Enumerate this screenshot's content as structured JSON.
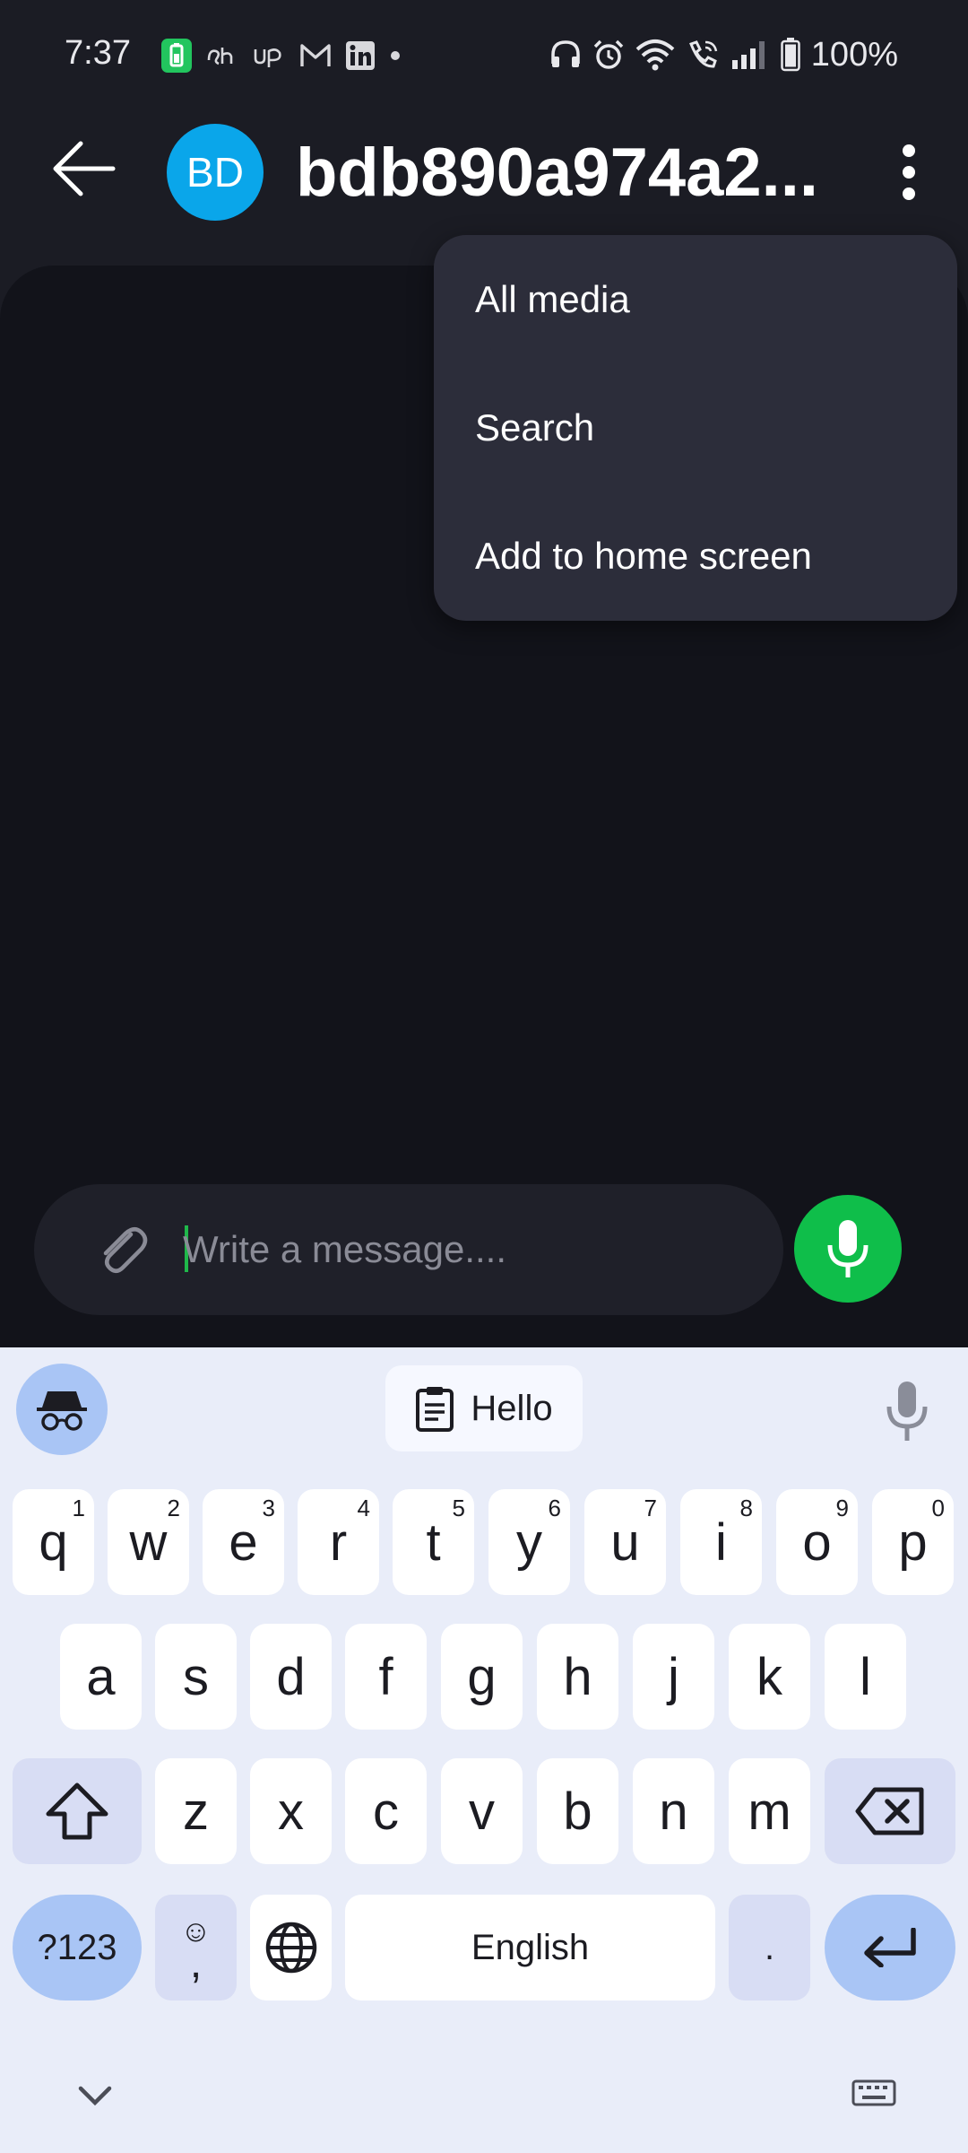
{
  "status_bar": {
    "time": "7:37",
    "battery_text": "100%",
    "left_icons": [
      "battery-saver-icon",
      "dh-app-icon",
      "up-app-icon",
      "gmail-icon",
      "linkedin-icon",
      "more-dot-icon"
    ],
    "right_icons": [
      "headphones-icon",
      "alarm-icon",
      "wifi-icon",
      "wifi-calling-icon",
      "signal-icon",
      "battery-icon"
    ]
  },
  "header": {
    "avatar_initials": "BD",
    "title": "bdb890a974a2...",
    "back_icon": "back-arrow-icon",
    "more_icon": "more-vertical-icon"
  },
  "menu": {
    "items": [
      {
        "label": "All media"
      },
      {
        "label": "Search"
      },
      {
        "label": "Add to home screen"
      }
    ]
  },
  "composer": {
    "placeholder": "Write a message....",
    "value": "",
    "attach_icon": "paperclip-icon",
    "action_icon": "microphone-icon"
  },
  "keyboard": {
    "suggestion_text": "Hello",
    "row1": [
      {
        "key": "q",
        "hint": "1"
      },
      {
        "key": "w",
        "hint": "2"
      },
      {
        "key": "e",
        "hint": "3"
      },
      {
        "key": "r",
        "hint": "4"
      },
      {
        "key": "t",
        "hint": "5"
      },
      {
        "key": "y",
        "hint": "6"
      },
      {
        "key": "u",
        "hint": "7"
      },
      {
        "key": "i",
        "hint": "8"
      },
      {
        "key": "o",
        "hint": "9"
      },
      {
        "key": "p",
        "hint": "0"
      }
    ],
    "row2": [
      "a",
      "s",
      "d",
      "f",
      "g",
      "h",
      "j",
      "k",
      "l"
    ],
    "row3": [
      "z",
      "x",
      "c",
      "v",
      "b",
      "n",
      "m"
    ],
    "symbols_label": "?123",
    "emoji_key_top": "☺",
    "emoji_key_bottom": ",",
    "space_label": "English",
    "period_label": "."
  },
  "colors": {
    "background": "#1b1c24",
    "chat_background": "#12131a",
    "menu_background": "#2c2d3a",
    "avatar": "#0aa6ea",
    "mic_button": "#0fbe4a",
    "keyboard_background": "#e9edf9",
    "keyboard_accent": "#a9c5f5"
  }
}
